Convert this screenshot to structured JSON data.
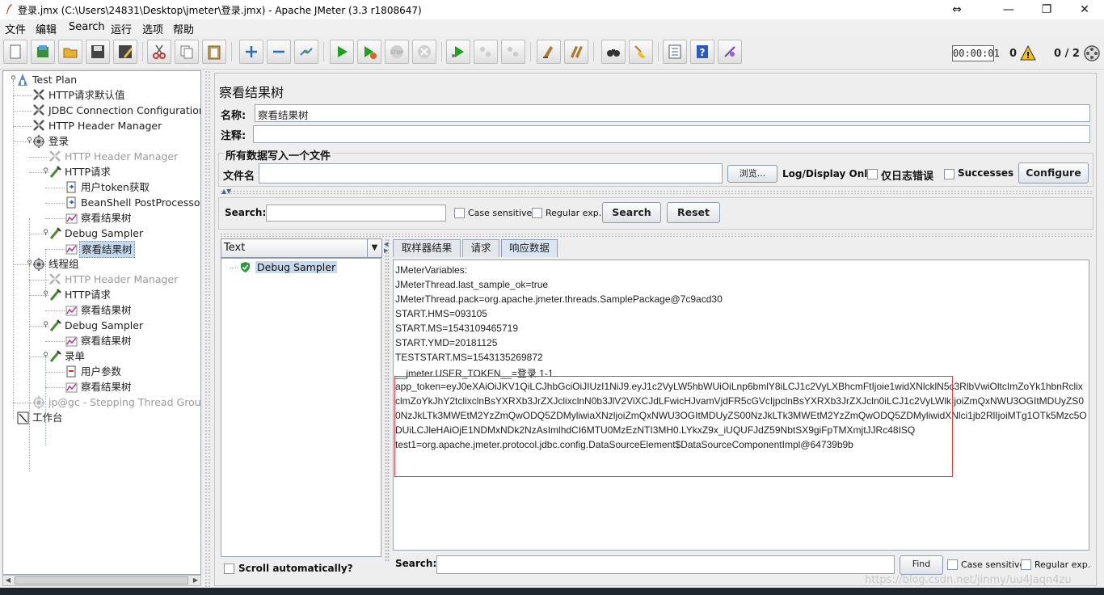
{
  "window": {
    "title": "登录.jmx (C:\\Users\\24831\\Desktop\\jmeter\\登录.jmx) - Apache JMeter (3.3 r1808647)"
  },
  "menu": [
    "文件",
    "编辑",
    "Search",
    "运行",
    "选项",
    "帮助"
  ],
  "toolbar": {
    "buttons": [
      "new-icon",
      "templates-icon",
      "open-icon",
      "save-icon",
      "save-as-icon",
      "cut-icon",
      "copy-icon",
      "paste-icon",
      "expand-icon",
      "collapse-icon",
      "toggle-icon",
      "start-icon",
      "start-no-pause-icon",
      "stop-icon",
      "shutdown-icon",
      "remote-start-icon",
      "remote-stop-icon",
      "remote-exit-icon",
      "clear-icon",
      "clear-all-icon",
      "search-icon",
      "reset-search-icon",
      "function-helper-icon",
      "help-icon",
      "log-viewer-icon"
    ],
    "timer": "00:00:01",
    "warnings": "0",
    "threads": "0 / 2"
  },
  "tree": {
    "nodes": [
      {
        "label": "Test Plan",
        "icon": "test-plan-icon",
        "level": 0
      },
      {
        "label": "HTTP请求默认值",
        "icon": "config-icon",
        "level": 1
      },
      {
        "label": "JDBC Connection Configuration",
        "icon": "config-icon",
        "level": 1
      },
      {
        "label": "HTTP Header Manager",
        "icon": "config-icon",
        "level": 1
      },
      {
        "label": "登录",
        "icon": "thread-group-icon",
        "level": 1
      },
      {
        "label": "HTTP Header Manager",
        "icon": "config-icon",
        "level": 2,
        "disabled": true
      },
      {
        "label": "HTTP请求",
        "icon": "sampler-icon",
        "level": 2
      },
      {
        "label": "用户token获取",
        "icon": "post-processor-icon",
        "level": 3
      },
      {
        "label": "BeanShell PostProcessor",
        "icon": "post-processor-icon",
        "level": 3
      },
      {
        "label": "察看结果树",
        "icon": "listener-icon",
        "level": 3
      },
      {
        "label": "Debug Sampler",
        "icon": "sampler-icon",
        "level": 2
      },
      {
        "label": "察看结果树",
        "icon": "listener-icon",
        "level": 3,
        "selected": true
      },
      {
        "label": "线程组",
        "icon": "thread-group-icon",
        "level": 1
      },
      {
        "label": "HTTP Header Manager",
        "icon": "config-icon",
        "level": 2,
        "disabled": true
      },
      {
        "label": "HTTP请求",
        "icon": "sampler-icon",
        "level": 2
      },
      {
        "label": "察看结果树",
        "icon": "listener-icon",
        "level": 3
      },
      {
        "label": "Debug Sampler",
        "icon": "sampler-icon",
        "level": 2
      },
      {
        "label": "察看结果树",
        "icon": "listener-icon",
        "level": 3
      },
      {
        "label": "录单",
        "icon": "sampler-icon",
        "level": 2
      },
      {
        "label": "用户参数",
        "icon": "pre-processor-icon",
        "level": 3
      },
      {
        "label": "察看结果树",
        "icon": "listener-icon",
        "level": 3
      },
      {
        "label": "jp@gc - Stepping Thread Group",
        "icon": "thread-group-icon",
        "level": 1,
        "disabled": true
      },
      {
        "label": "工作台",
        "icon": "workbench-icon",
        "level": 0
      }
    ]
  },
  "panel": {
    "title": "察看结果树",
    "name_label": "名称:",
    "name_value": "察看结果树",
    "comment_label": "注释:",
    "comment_value": "",
    "file_group_title": "所有数据写入一个文件",
    "filename_label": "文件名",
    "filename_value": "",
    "browse_label": "浏览...",
    "log_display_label": "Log/Display Only:",
    "errors_only_label": "仅日志错误",
    "successes_label": "Successes",
    "configure_label": "Configure"
  },
  "search": {
    "label": "Search:",
    "value": "",
    "case_sensitive_label": "Case sensitive",
    "regex_label": "Regular exp.",
    "search_button": "Search",
    "reset_button": "Reset"
  },
  "results": {
    "renderer": "Text",
    "items": [
      "Debug Sampler"
    ],
    "scroll_auto_label": "Scroll automatically?",
    "tabs": [
      "取样器结果",
      "请求",
      "响应数据"
    ],
    "active_tab": "响应数据",
    "response_lines": [
      "JMeterVariables:",
      "JMeterThread.last_sample_ok=true",
      "JMeterThread.pack=org.apache.jmeter.threads.SamplePackage@7c9acd30",
      "START.HMS=093105",
      "START.MS=1543109465719",
      "START.YMD=20181125",
      "TESTSTART.MS=1543135269872",
      "__jmeter.USER_TOKEN__=登录 1-1",
      "app_token=eyJ0eXAiOiJKV1QiLCJhbGciOiJIUzI1NiJ9.eyJ1c2VyLW5hbWUiOiLnp6bmlY8iLCJ1c2VyLXBhcmFtIjoie1widXNlcklN5c3RlbVwiOltcImZoYk1hbnRclix",
      "clmZoYkJhY2tclixclnBsYXRXb3JrZXJclixclnN0b3JlV2ViXCJdLFwicHJvamVjdFR5cGVcIjpclnBsYXRXb3JrZXJcln0iLCJ1c2VyLWlkIjoiZmQxNWU3OGItMDUyZS0",
      "0NzJkLTk3MWEtM2YzZmQwODQ5ZDMyliwiaXNzljoiZmQxNWU3OGItMDUyZS00NzJkLTk3MWEtM2YzZmQwODQ5ZDMyliwidXNlci1jb2RlIjoiMTg1OTk5Mzc5O",
      "DUiLCJleHAiOjE1NDMxNDk2NzAsImlhdCI6MTU0MzEzNTI3MH0.LYkxZ9x_iUQUFJdZ59NbtSX9giFpTMXmjtJJRc48ISQ",
      "test1=org.apache.jmeter.protocol.jdbc.config.DataSourceElement$DataSourceComponentImpl@64739b9b"
    ],
    "bottom_search_label": "Search:",
    "bottom_search_value": "",
    "find_button": "Find",
    "bottom_case_label": "Case sensitive",
    "bottom_regex_label": "Regular exp."
  },
  "watermark": "https://blog.csdn.net/jinmy/uu4Jaqn4zu",
  "colors": {
    "selection": "#c6d8ec",
    "highlight_box": "#e04040",
    "start_green": "#1fa31f"
  }
}
